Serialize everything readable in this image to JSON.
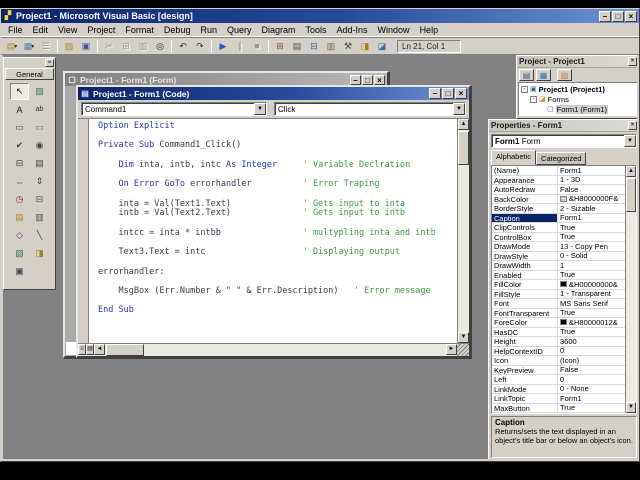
{
  "window": {
    "title": "Project1 - Microsoft Visual Basic [design]"
  },
  "menu": {
    "items": [
      "File",
      "Edit",
      "View",
      "Project",
      "Format",
      "Debug",
      "Run",
      "Query",
      "Diagram",
      "Tools",
      "Add-Ins",
      "Window",
      "Help"
    ]
  },
  "toolbar": {
    "position_indicator": "Ln 21, Col 1",
    "buttons": [
      {
        "name": "add-project",
        "glyph": "▤",
        "color": "#b08828",
        "dropdown": true
      },
      {
        "name": "add-form",
        "glyph": "▦",
        "color": "#5878a0",
        "dropdown": true
      },
      {
        "name": "menu-editor",
        "glyph": "☰",
        "color": "#8a8678",
        "disabled": true
      },
      {
        "name": "open-project",
        "glyph": "▨",
        "color": "#b08828",
        "sep": true
      },
      {
        "name": "save-project",
        "glyph": "▣",
        "color": "#3a5490"
      },
      {
        "name": "cut",
        "glyph": "✂",
        "disabled": true,
        "sep": true
      },
      {
        "name": "copy",
        "glyph": "⊞",
        "disabled": true
      },
      {
        "name": "paste",
        "glyph": "▥",
        "disabled": true
      },
      {
        "name": "find",
        "glyph": "◎",
        "color": "#222222"
      },
      {
        "name": "undo",
        "glyph": "↶",
        "color": "#333333",
        "sep": true
      },
      {
        "name": "redo",
        "glyph": "↷",
        "color": "#333333"
      },
      {
        "name": "start",
        "glyph": "▶",
        "color": "#3050b8",
        "sep": true
      },
      {
        "name": "break",
        "glyph": "∥",
        "disabled": true
      },
      {
        "name": "end",
        "glyph": "■",
        "disabled": true
      },
      {
        "name": "project-explorer",
        "glyph": "⊞",
        "color": "#806020",
        "sep": true
      },
      {
        "name": "properties-window",
        "glyph": "▤",
        "color": "#604828"
      },
      {
        "name": "form-layout",
        "glyph": "⊟",
        "color": "#406080"
      },
      {
        "name": "object-browser",
        "glyph": "▥",
        "color": "#806040"
      },
      {
        "name": "toolbox",
        "glyph": "⚒",
        "color": "#504030"
      },
      {
        "name": "data-view",
        "glyph": "◨",
        "color": "#a08020"
      },
      {
        "name": "component-manager",
        "glyph": "◪",
        "color": "#3868a8"
      }
    ]
  },
  "toolbox": {
    "tab_label": "General",
    "tools": [
      {
        "name": "pointer",
        "glyph": "↖",
        "color": "#000000",
        "pressed": true
      },
      {
        "name": "picturebox",
        "glyph": "▨",
        "color": "#3a7a50"
      },
      {
        "name": "label",
        "glyph": "A",
        "color": "#202020"
      },
      {
        "name": "textbox",
        "glyph": "ab",
        "color": "#303030"
      },
      {
        "name": "frame",
        "glyph": "▭",
        "color": "#505050"
      },
      {
        "name": "commandbutton",
        "glyph": "▭",
        "color": "#707070"
      },
      {
        "name": "checkbox",
        "glyph": "✔",
        "color": "#404040"
      },
      {
        "name": "optionbutton",
        "glyph": "◉",
        "color": "#404040"
      },
      {
        "name": "combobox",
        "glyph": "⊟",
        "color": "#404040"
      },
      {
        "name": "listbox",
        "glyph": "▤",
        "color": "#404040"
      },
      {
        "name": "hscrollbar",
        "glyph": "⇔",
        "color": "#404040"
      },
      {
        "name": "vscrollbar",
        "glyph": "⇕",
        "color": "#404040"
      },
      {
        "name": "timer",
        "glyph": "◷",
        "color": "#802020"
      },
      {
        "name": "drivelistbox",
        "glyph": "⊟",
        "color": "#505050"
      },
      {
        "name": "dirlistbox",
        "glyph": "▤",
        "color": "#b08828"
      },
      {
        "name": "filelistbox",
        "glyph": "▥",
        "color": "#505050"
      },
      {
        "name": "shape",
        "glyph": "◇",
        "color": "#602080"
      },
      {
        "name": "line",
        "glyph": "╲",
        "color": "#404040"
      },
      {
        "name": "image",
        "glyph": "▧",
        "color": "#3a7a50"
      },
      {
        "name": "data",
        "glyph": "◨",
        "color": "#a08020"
      },
      {
        "name": "ole",
        "glyph": "▣",
        "color": "#404060"
      }
    ]
  },
  "form_window": {
    "title": "Project1 - Form1 (Form)"
  },
  "code_window": {
    "title": "Project1 - Form1 (Code)",
    "object_combo": "Command1",
    "procedure_combo": "Click",
    "lines": [
      [
        {
          "c": "k",
          "t": "Option Explicit"
        }
      ],
      [],
      [
        {
          "c": "k",
          "t": "Private Sub "
        },
        {
          "c": "n",
          "t": "Command1_Click()"
        }
      ],
      [],
      [
        {
          "c": "n",
          "t": "    "
        },
        {
          "c": "k",
          "t": "Dim"
        },
        {
          "c": "n",
          "t": " inta, intb, intc "
        },
        {
          "c": "k",
          "t": "As Integer"
        },
        {
          "c": "n",
          "t": "     "
        },
        {
          "c": "c",
          "t": "' Variable Declration"
        }
      ],
      [],
      [
        {
          "c": "n",
          "t": "    "
        },
        {
          "c": "k",
          "t": "On Error GoTo"
        },
        {
          "c": "n",
          "t": " errorhandler          "
        },
        {
          "c": "c",
          "t": "' Error Traping"
        }
      ],
      [],
      [
        {
          "c": "n",
          "t": "    inta = Val(Text1.Text)              "
        },
        {
          "c": "c",
          "t": "' Gets input to inta"
        }
      ],
      [
        {
          "c": "n",
          "t": "    intb = Val(Text2.Text)              "
        },
        {
          "c": "c",
          "t": "' Gets input to intb"
        }
      ],
      [],
      [
        {
          "c": "n",
          "t": "    intcc = inta * intbb                "
        },
        {
          "c": "c",
          "t": "' multypling inta and intb"
        }
      ],
      [],
      [
        {
          "c": "n",
          "t": "    Text3.Text = intc                   "
        },
        {
          "c": "c",
          "t": "' Displaying output"
        }
      ],
      [],
      [
        {
          "c": "n",
          "t": "errorhandler:"
        }
      ],
      [],
      [
        {
          "c": "n",
          "t": "    MsgBox (Err.Number & \" \" & Err.Description)   "
        },
        {
          "c": "c",
          "t": "' Error message"
        }
      ],
      [],
      [
        {
          "c": "k",
          "t": "End Sub"
        }
      ]
    ]
  },
  "project_panel": {
    "title": "Project - Project1",
    "tree": {
      "root": "Project1 (Project1)",
      "folder": "Forms",
      "form": "Form1 (Form1)"
    }
  },
  "properties_panel": {
    "title": "Properties - Form1",
    "object_name": "Form1",
    "object_type": "Form",
    "tabs": [
      "Alphabetic",
      "Categorized"
    ],
    "rows": [
      {
        "n": "(Name)",
        "v": "Form1"
      },
      {
        "n": "Appearance",
        "v": "1 - 3D"
      },
      {
        "n": "AutoRedraw",
        "v": "False"
      },
      {
        "n": "BackColor",
        "v": "&H8000000F&",
        "sw": "#d4d0c8"
      },
      {
        "n": "BorderStyle",
        "v": "2 - Sizable"
      },
      {
        "n": "Caption",
        "v": "Form1",
        "sel": true
      },
      {
        "n": "ClipControls",
        "v": "True"
      },
      {
        "n": "ControlBox",
        "v": "True"
      },
      {
        "n": "DrawMode",
        "v": "13 - Copy Pen"
      },
      {
        "n": "DrawStyle",
        "v": "0 - Solid"
      },
      {
        "n": "DrawWidth",
        "v": "1"
      },
      {
        "n": "Enabled",
        "v": "True"
      },
      {
        "n": "FillColor",
        "v": "&H00000000&",
        "sw": "#000000"
      },
      {
        "n": "FillStyle",
        "v": "1 - Transparent"
      },
      {
        "n": "Font",
        "v": "MS Sans Serif"
      },
      {
        "n": "FontTransparent",
        "v": "True"
      },
      {
        "n": "ForeColor",
        "v": "&H80000012&",
        "sw": "#000000"
      },
      {
        "n": "HasDC",
        "v": "True"
      },
      {
        "n": "Height",
        "v": "3600"
      },
      {
        "n": "HelpContextID",
        "v": "0"
      },
      {
        "n": "Icon",
        "v": "(Icon)"
      },
      {
        "n": "KeyPreview",
        "v": "False"
      },
      {
        "n": "Left",
        "v": "0"
      },
      {
        "n": "LinkMode",
        "v": "0 - None"
      },
      {
        "n": "LinkTopic",
        "v": "Form1"
      },
      {
        "n": "MaxButton",
        "v": "True"
      }
    ],
    "description_title": "Caption",
    "description_text": "Returns/sets the text displayed in an object's title bar or below an object's icon."
  },
  "glyphs": {
    "minimize": "–",
    "maximize": "□",
    "close": "×",
    "dropdown": "▼",
    "up": "▲",
    "down": "▼",
    "left": "◄",
    "right": "►"
  }
}
